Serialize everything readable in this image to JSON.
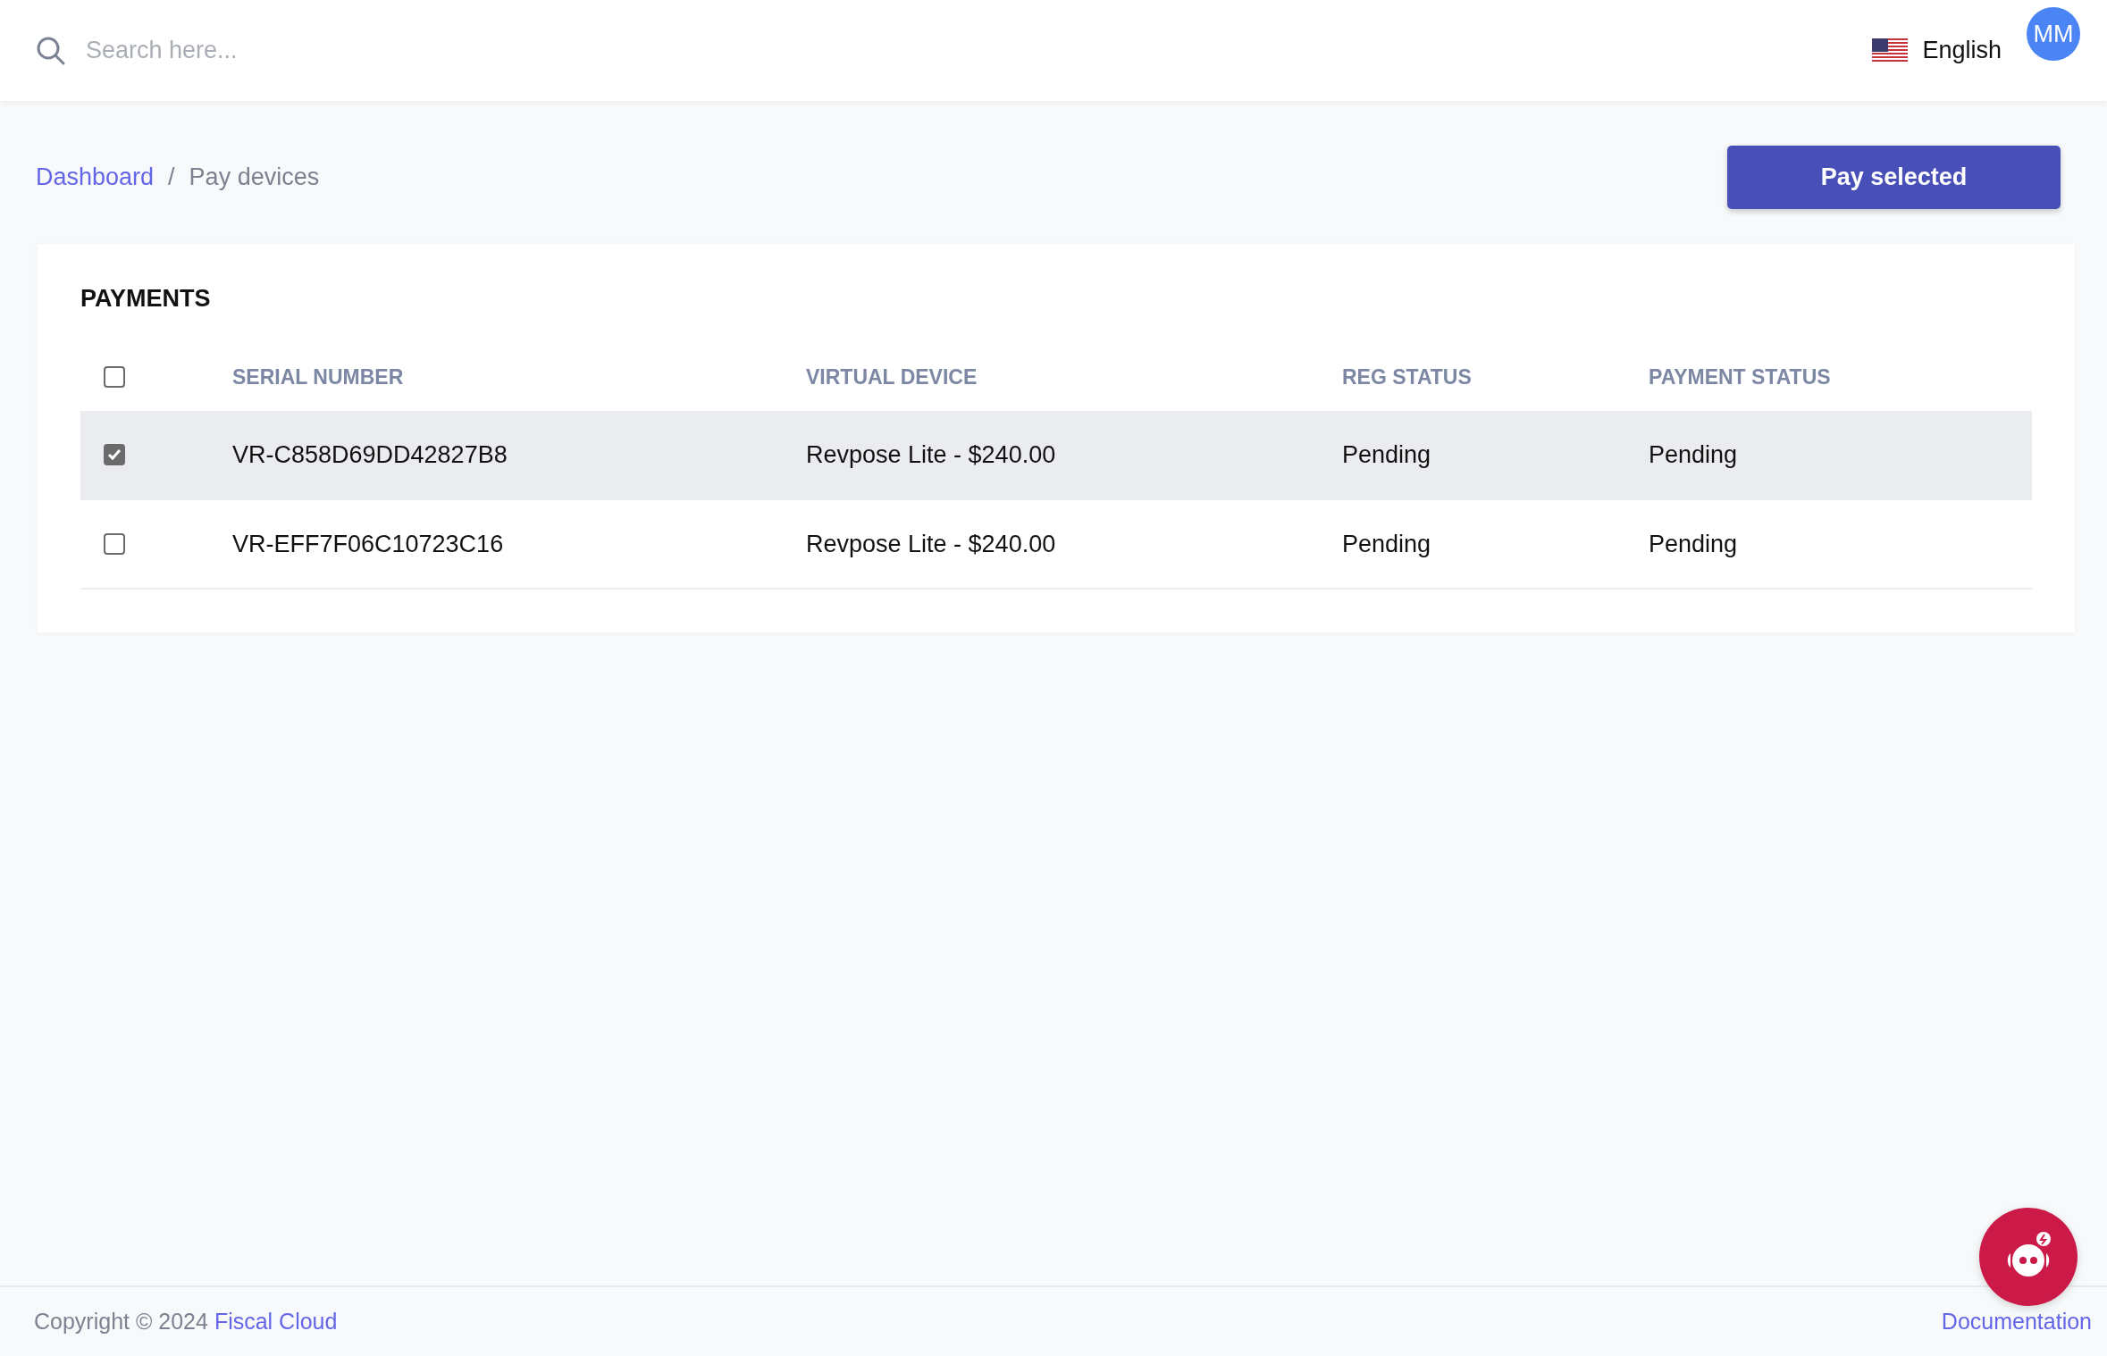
{
  "topbar": {
    "search": {
      "placeholder": "Search here..."
    },
    "language": "English",
    "avatar": "MM"
  },
  "breadcrumb": [
    {
      "label": "Dashboard",
      "kind": "link"
    },
    {
      "label": "Pay devices",
      "kind": "current"
    }
  ],
  "breadcrumb_separator": "/",
  "action_button": "Pay selected",
  "payments": {
    "title": "PAYMENTS",
    "select_all_checked": false,
    "columns": [
      "SERIAL NUMBER",
      "VIRTUAL DEVICE",
      "REG STATUS",
      "PAYMENT STATUS"
    ],
    "rows": [
      {
        "checked": true,
        "selected": true,
        "cells": [
          "VR-C858D69DD42827B8",
          "Revpose Lite - $240.00",
          "Pending",
          "Pending"
        ]
      },
      {
        "checked": false,
        "selected": false,
        "cells": [
          "VR-EFF7F06C10723C16",
          "Revpose Lite - $240.00",
          "Pending",
          "Pending"
        ]
      }
    ]
  },
  "footer": {
    "copyright": "Copyright © 2024",
    "company": "Fiscal Cloud",
    "documentation": "Documentation"
  }
}
